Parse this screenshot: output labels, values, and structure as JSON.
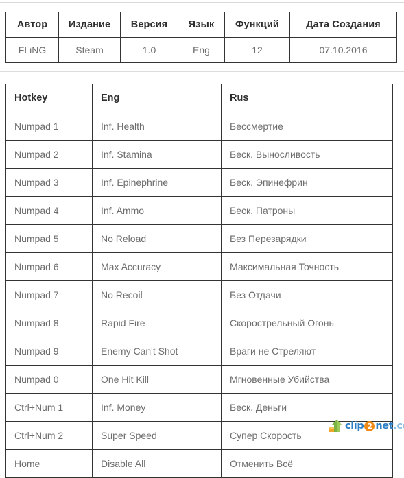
{
  "info_table": {
    "headers": [
      "Автор",
      "Издание",
      "Версия",
      "Язык",
      "Функций",
      "Дата Создания"
    ],
    "rows": [
      [
        "FLiNG",
        "Steam",
        "1.0",
        "Eng",
        "12",
        "07.10.2016"
      ]
    ]
  },
  "hotkey_table": {
    "headers": [
      "Hotkey",
      "Eng",
      "Rus"
    ],
    "rows": [
      [
        "Numpad 1",
        "Inf. Health",
        "Бессмертие"
      ],
      [
        "Numpad 2",
        "Inf. Stamina",
        "Беск. Выносливость"
      ],
      [
        "Numpad 3",
        "Inf. Epinephrine",
        "Беск. Эпинефрин"
      ],
      [
        "Numpad 4",
        "Inf. Ammo",
        "Беск. Патроны"
      ],
      [
        "Numpad 5",
        "No Reload",
        "Без Перезарядки"
      ],
      [
        "Numpad 6",
        "Max Accuracy",
        "Максимальная Точность"
      ],
      [
        "Numpad 7",
        "No Recoil",
        "Без Отдачи"
      ],
      [
        "Numpad 8",
        "Rapid Fire",
        "Скорострельный Огонь"
      ],
      [
        "Numpad 9",
        "Enemy Can't Shot",
        "Враги не Стреляют"
      ],
      [
        "Numpad 0",
        "One Hit Kill",
        "Мгновенные Убийства"
      ],
      [
        "Ctrl+Num 1",
        "Inf. Money",
        "Беск. Деньги"
      ],
      [
        "Ctrl+Num 2",
        "Super Speed",
        "Супер Скорость"
      ],
      [
        "Home",
        "Disable All",
        "Отменить Всё"
      ]
    ]
  },
  "watermark": {
    "icon": "upload-arrow-icon",
    "part1": "clip",
    "part2": "2",
    "part3": "net",
    "part4": ".com"
  },
  "colors": {
    "border": "#343434",
    "header_text": "#2e2e2e",
    "body_text": "#6d6d6d",
    "rule": "#d9d9d9",
    "brand_blue": "#2e7fc4",
    "brand_orange": "#f08a16"
  }
}
